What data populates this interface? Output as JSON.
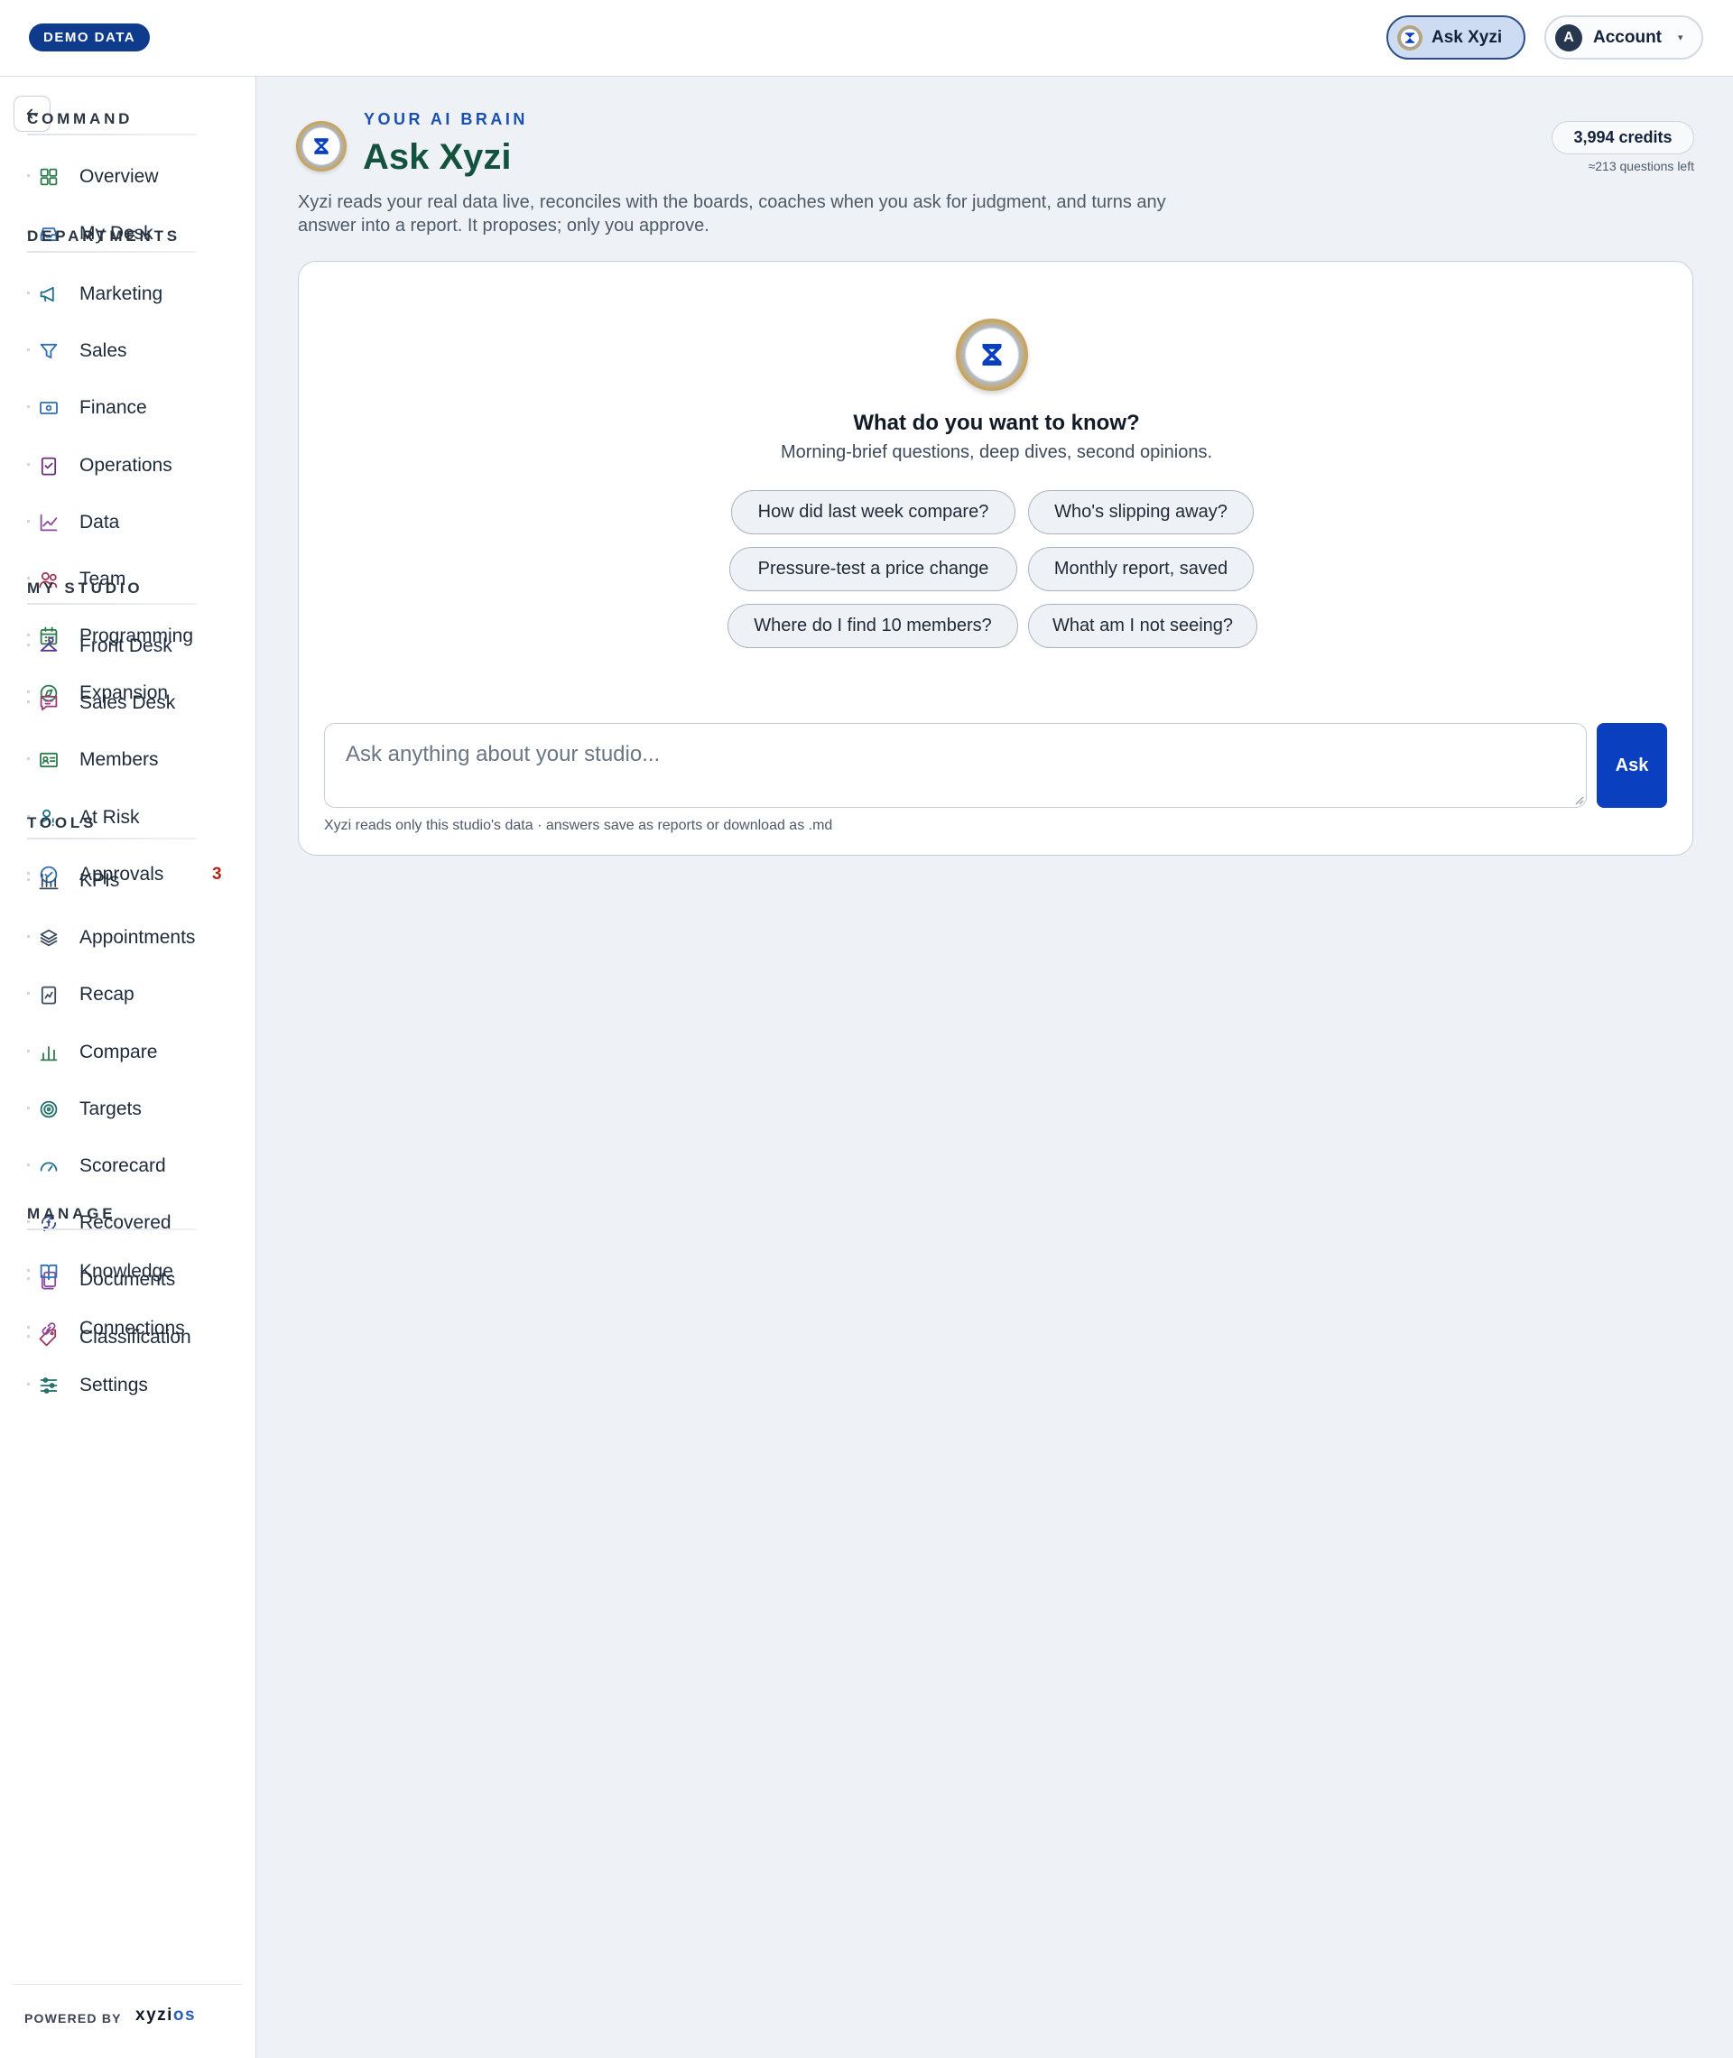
{
  "topbar": {
    "demo_badge": "DEMO DATA",
    "ask_button": "Ask Xyzi",
    "account": {
      "initial": "A",
      "label": "Account",
      "caret": "▾"
    }
  },
  "sidebar": {
    "collapse_icon": "arrow-left-icon",
    "sections": [
      {
        "title": "COMMAND",
        "items": [
          {
            "label": "Overview",
            "icon": "grid-icon",
            "color": "#2f7a4e"
          },
          {
            "label": "My Desk",
            "icon": "inbox-icon",
            "color": "#2f6db5"
          }
        ]
      },
      {
        "title": "DEPARTMENTS",
        "items": [
          {
            "label": "Marketing",
            "icon": "megaphone-icon",
            "color": "#1f6f8b"
          },
          {
            "label": "Sales",
            "icon": "funnel-icon",
            "color": "#2f6db5"
          },
          {
            "label": "Finance",
            "icon": "banknote-icon",
            "color": "#2f6db5"
          },
          {
            "label": "Operations",
            "icon": "clipboard-check-icon",
            "color": "#6b2f7a"
          },
          {
            "label": "Data",
            "icon": "line-chart-icon",
            "color": "#8a4a9c"
          },
          {
            "label": "Team",
            "icon": "users-icon",
            "color": "#9c3a5a"
          },
          {
            "label": "Programming",
            "icon": "calendar-grid-icon",
            "color": "#2f7a4e"
          },
          {
            "label": "Expansion",
            "icon": "compass-icon",
            "color": "#2f7a4e"
          }
        ]
      },
      {
        "title": "MY STUDIO",
        "items": [
          {
            "label": "Front Desk",
            "icon": "hanger-icon",
            "color": "#5a3a8c"
          },
          {
            "label": "Sales Desk",
            "icon": "chat-icon",
            "color": "#9c3a7a"
          },
          {
            "label": "Members",
            "icon": "id-card-icon",
            "color": "#2f7a4e"
          },
          {
            "label": "At Risk",
            "icon": "user-alert-icon",
            "color": "#1f6f8b"
          },
          {
            "label": "Approvals",
            "icon": "check-circle-icon",
            "color": "#2f6db5",
            "count": "3"
          }
        ]
      },
      {
        "title": "TOOLS",
        "items": [
          {
            "label": "KPIs",
            "icon": "bar-gauge-icon",
            "color": "#3a4a5c"
          },
          {
            "label": "Appointments",
            "icon": "layers-icon",
            "color": "#3a4a5c"
          },
          {
            "label": "Recap",
            "icon": "report-icon",
            "color": "#3a4a5c"
          },
          {
            "label": "Compare",
            "icon": "bar-chart-icon",
            "color": "#2f7a4e"
          },
          {
            "label": "Targets",
            "icon": "target-icon",
            "color": "#1f6f6b"
          },
          {
            "label": "Scorecard",
            "icon": "gauge-icon",
            "color": "#1f6f8b"
          },
          {
            "label": "Recovered",
            "icon": "refresh-coin-icon",
            "color": "#3a4a8c"
          },
          {
            "label": "Documents",
            "icon": "files-icon",
            "color": "#8a4a9c"
          },
          {
            "label": "Classification",
            "icon": "tag-icon",
            "color": "#9c3a5a"
          }
        ]
      },
      {
        "title": "MANAGE",
        "items": [
          {
            "label": "Knowledge",
            "icon": "book-icon",
            "color": "#2f6db5"
          },
          {
            "label": "Connections",
            "icon": "link-icon",
            "color": "#8a4a9c"
          },
          {
            "label": "Settings",
            "icon": "sliders-icon",
            "color": "#1f6f6b"
          }
        ]
      }
    ],
    "powered_by": "POWERED BY",
    "brand_main": "xyzi",
    "brand_suffix": "os"
  },
  "main": {
    "eyebrow": "YOUR AI BRAIN",
    "title": "Ask Xyzi",
    "description": "Xyzi reads your real data live, reconciles with the boards, coaches when you ask for judgment, and turns any answer into a report. It proposes; only you approve.",
    "credits": "3,994 credits",
    "credits_sub": "≈213 questions left",
    "card": {
      "heading": "What do you want to know?",
      "subheading": "Morning-brief questions, deep dives, second opinions.",
      "chips": [
        "How did last week compare?",
        "Who's slipping away?",
        "Pressure-test a price change",
        "Monthly report, saved",
        "Where do I find 10 members?",
        "What am I not seeing?"
      ],
      "input_placeholder": "Ask anything about your studio...",
      "ask_label": "Ask",
      "footnote": "Xyzi reads only this studio's data · answers save as reports or download as .md"
    }
  },
  "colors": {
    "brand_blue": "#0a3fbf",
    "title_green": "#14523d",
    "badge_red": "#b3261e"
  }
}
